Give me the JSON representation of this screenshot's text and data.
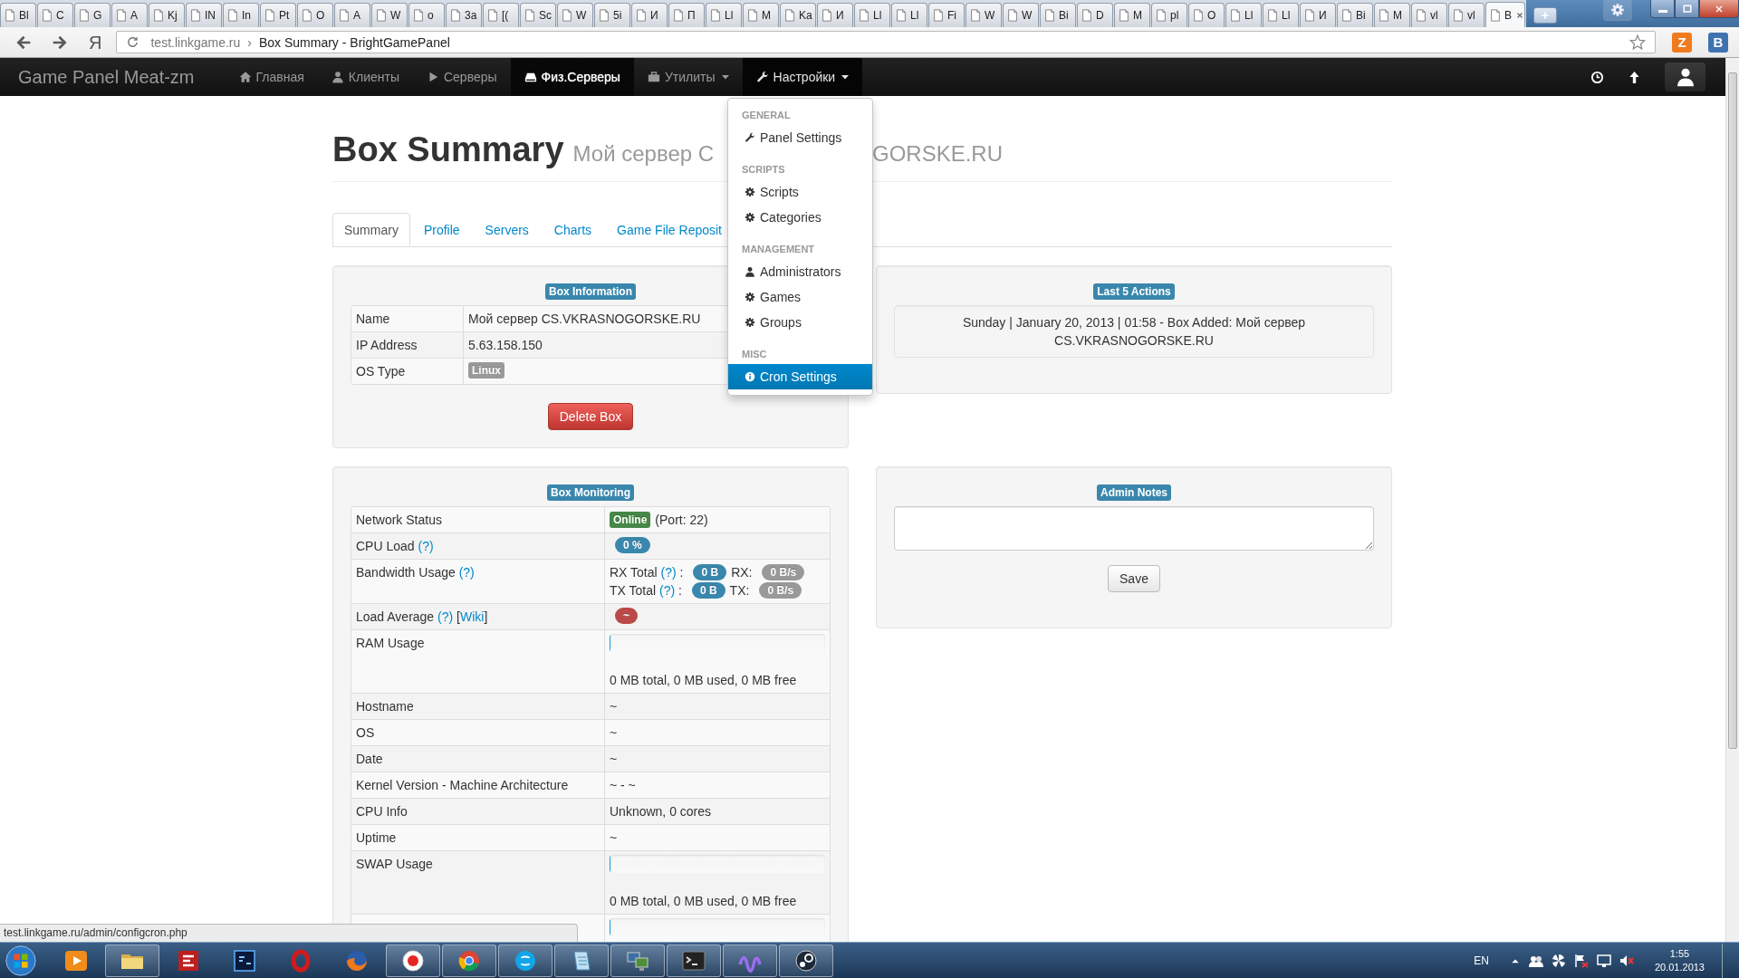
{
  "browser": {
    "tabs": [
      {
        "title": "Bl",
        "selected": false
      },
      {
        "title": "C",
        "selected": false
      },
      {
        "title": "G",
        "selected": false
      },
      {
        "title": "A",
        "selected": false
      },
      {
        "title": "Kj",
        "selected": false
      },
      {
        "title": "IN",
        "selected": false
      },
      {
        "title": "In",
        "selected": false
      },
      {
        "title": "Pt",
        "selected": false
      },
      {
        "title": "O",
        "selected": false
      },
      {
        "title": "A",
        "selected": false
      },
      {
        "title": "W",
        "selected": false
      },
      {
        "title": "o",
        "selected": false
      },
      {
        "title": "3a",
        "selected": false
      },
      {
        "title": "[(",
        "selected": false
      },
      {
        "title": "Sc",
        "selected": false
      },
      {
        "title": "W",
        "selected": false
      },
      {
        "title": "5i",
        "selected": false
      },
      {
        "title": "И",
        "selected": false
      },
      {
        "title": "П",
        "selected": false
      },
      {
        "title": "Ll",
        "selected": false
      },
      {
        "title": "M",
        "selected": false
      },
      {
        "title": "Ka",
        "selected": false
      },
      {
        "title": "И",
        "selected": false
      },
      {
        "title": "Ll",
        "selected": false
      },
      {
        "title": "Ll",
        "selected": false
      },
      {
        "title": "Fi",
        "selected": false
      },
      {
        "title": "W",
        "selected": false
      },
      {
        "title": "W",
        "selected": false
      },
      {
        "title": "Bi",
        "selected": false
      },
      {
        "title": "D",
        "selected": false
      },
      {
        "title": "M",
        "selected": false
      },
      {
        "title": "pl",
        "selected": false
      },
      {
        "title": "O",
        "selected": false
      },
      {
        "title": "Ll",
        "selected": false
      },
      {
        "title": "Ll",
        "selected": false
      },
      {
        "title": "И",
        "selected": false
      },
      {
        "title": "Bi",
        "selected": false
      },
      {
        "title": "M",
        "selected": false
      },
      {
        "title": "vl",
        "selected": false
      },
      {
        "title": "vl",
        "selected": false
      },
      {
        "title": "B",
        "selected": true
      }
    ],
    "search_engine": "Я",
    "address": {
      "host": "test.linkgame.ru",
      "separator": "›",
      "title": "Box Summary - BrightGamePanel"
    },
    "extensions": [
      "Z",
      "B"
    ]
  },
  "navbar": {
    "brand": "Game Panel Meat-zm",
    "items": [
      {
        "label": "Главная",
        "selected": false,
        "expanded": false,
        "dropdown": false
      },
      {
        "label": "Клиенты",
        "selected": false,
        "expanded": false,
        "dropdown": false
      },
      {
        "label": "Серверы",
        "selected": false,
        "expanded": false,
        "dropdown": false
      },
      {
        "label": "Физ.Серверы",
        "selected": true,
        "expanded": false,
        "dropdown": false
      },
      {
        "label": "Утилиты",
        "selected": false,
        "expanded": false,
        "dropdown": true
      },
      {
        "label": "Настройки",
        "selected": false,
        "expanded": true,
        "dropdown": true
      }
    ]
  },
  "menu": {
    "sections": [
      {
        "header": "GENERAL",
        "items": [
          {
            "label": "Panel Settings",
            "selected": false
          }
        ]
      },
      {
        "header": "SCRIPTS",
        "items": [
          {
            "label": "Scripts",
            "selected": false
          },
          {
            "label": "Categories",
            "selected": false
          }
        ]
      },
      {
        "header": "MANAGEMENT",
        "items": [
          {
            "label": "Administrators",
            "selected": false
          },
          {
            "label": "Games",
            "selected": false
          },
          {
            "label": "Groups",
            "selected": false
          }
        ]
      },
      {
        "header": "MISC",
        "items": [
          {
            "label": "Cron Settings",
            "selected": true
          }
        ]
      }
    ]
  },
  "page": {
    "title": "Box Summary",
    "subtitle_parts": [
      "Мой сервер C",
      "GORSKE.RU"
    ],
    "tabs": [
      {
        "label": "Summary",
        "selected": true
      },
      {
        "label": "Profile",
        "selected": false
      },
      {
        "label": "Servers",
        "selected": false
      },
      {
        "label": "Charts",
        "selected": false
      },
      {
        "label": "Game File Reposit",
        "selected": false
      }
    ],
    "box_information": {
      "badge": "Box Information",
      "rows": [
        {
          "label": [
            {
              "kind": "text",
              "text": "Name"
            }
          ],
          "value": [
            [
              {
                "kind": "text",
                "text": "Мой сервер CS.VKRASNOGORSKE.RU"
              }
            ]
          ]
        },
        {
          "label": [
            {
              "kind": "text",
              "text": "IP Address"
            }
          ],
          "value": [
            [
              {
                "kind": "text",
                "text": "5.63.158.150"
              }
            ]
          ]
        },
        {
          "label": [
            {
              "kind": "text",
              "text": "OS Type"
            }
          ],
          "value": [
            [
              {
                "kind": "label",
                "text": "Linux",
                "color": "#999999"
              }
            ]
          ]
        }
      ],
      "delete_button": "Delete Box"
    },
    "last_actions": {
      "badge": "Last 5 Actions",
      "entries": [
        "Sunday | January 20, 2013 | 01:58 - Box Added: Мой сервер CS.VKRASNOGORSKE.RU"
      ]
    },
    "box_monitoring": {
      "badge": "Box Monitoring",
      "rows": [
        {
          "label": [
            {
              "kind": "text",
              "text": "Network Status"
            }
          ],
          "value": [
            [
              {
                "kind": "label",
                "text": "Online",
                "color": "#468847"
              },
              {
                "kind": "text",
                "text": "(Port: 22)"
              }
            ]
          ]
        },
        {
          "label": [
            {
              "kind": "text",
              "text": "CPU Load "
            },
            {
              "kind": "link",
              "text": "(?)"
            }
          ],
          "value": [
            [
              {
                "kind": "badge",
                "text": "0 %",
                "color": "#3a87ad"
              }
            ]
          ]
        },
        {
          "label": [
            {
              "kind": "text",
              "text": "Bandwidth Usage "
            },
            {
              "kind": "link",
              "text": "(?)"
            }
          ],
          "value": [
            [
              {
                "kind": "text",
                "text": "RX Total "
              },
              {
                "kind": "link",
                "text": "(?)"
              },
              {
                "kind": "text",
                "text": " :"
              },
              {
                "kind": "badge",
                "text": "0 B",
                "color": "#3a87ad"
              },
              {
                "kind": "text",
                "text": "RX:"
              },
              {
                "kind": "badge",
                "text": "0 B/s",
                "color": "#999999"
              }
            ],
            [
              {
                "kind": "text",
                "text": "TX Total "
              },
              {
                "kind": "link",
                "text": "(?)"
              },
              {
                "kind": "text",
                "text": " :"
              },
              {
                "kind": "badge",
                "text": "0 B",
                "color": "#3a87ad"
              },
              {
                "kind": "text",
                "text": "TX:"
              },
              {
                "kind": "badge",
                "text": "0 B/s",
                "color": "#999999"
              }
            ]
          ]
        },
        {
          "label": [
            {
              "kind": "text",
              "text": "Load Average "
            },
            {
              "kind": "link",
              "text": "(?)"
            },
            {
              "kind": "text",
              "text": " ["
            },
            {
              "kind": "link",
              "text": "Wiki"
            },
            {
              "kind": "text",
              "text": "]"
            }
          ],
          "value": [
            [
              {
                "kind": "badge",
                "text": "~",
                "color": "#b94a48"
              }
            ]
          ]
        },
        {
          "label": [
            {
              "kind": "text",
              "text": "RAM Usage"
            }
          ],
          "value": [
            [
              {
                "kind": "progress",
                "level": 0
              }
            ],
            [
              {
                "kind": "text",
                "text": "0 MB total, 0 MB used, 0 MB free"
              }
            ]
          ]
        },
        {
          "label": [
            {
              "kind": "text",
              "text": "Hostname"
            }
          ],
          "value": [
            [
              {
                "kind": "text",
                "text": "~"
              }
            ]
          ]
        },
        {
          "label": [
            {
              "kind": "text",
              "text": "OS"
            }
          ],
          "value": [
            [
              {
                "kind": "text",
                "text": "~"
              }
            ]
          ]
        },
        {
          "label": [
            {
              "kind": "text",
              "text": "Date"
            }
          ],
          "value": [
            [
              {
                "kind": "text",
                "text": "~"
              }
            ]
          ]
        },
        {
          "label": [
            {
              "kind": "text",
              "text": "Kernel Version - Machine Architecture"
            }
          ],
          "value": [
            [
              {
                "kind": "text",
                "text": "~ - ~"
              }
            ]
          ]
        },
        {
          "label": [
            {
              "kind": "text",
              "text": "CPU Info"
            }
          ],
          "value": [
            [
              {
                "kind": "text",
                "text": "Unknown, 0 cores"
              }
            ]
          ]
        },
        {
          "label": [
            {
              "kind": "text",
              "text": "Uptime"
            }
          ],
          "value": [
            [
              {
                "kind": "text",
                "text": "~"
              }
            ]
          ]
        },
        {
          "label": [
            {
              "kind": "text",
              "text": "SWAP Usage"
            }
          ],
          "value": [
            [
              {
                "kind": "progress",
                "level": 0
              }
            ],
            [
              {
                "kind": "text",
                "text": "0 MB total, 0 MB used, 0 MB free"
              }
            ]
          ]
        },
        {
          "value": [
            [
              {
                "kind": "progress",
                "level": 0
              }
            ]
          ]
        }
      ]
    },
    "admin_notes": {
      "badge": "Admin Notes",
      "save_button": "Save"
    }
  },
  "status_url": "test.linkgame.ru/admin/configcron.php",
  "taskbar": {
    "apps": [
      {
        "running": false
      },
      {
        "running": true
      },
      {
        "running": false
      },
      {
        "running": false
      },
      {
        "running": false
      },
      {
        "running": false
      },
      {
        "running": true
      },
      {
        "running": true
      },
      {
        "running": true
      },
      {
        "running": true
      },
      {
        "running": true
      },
      {
        "running": true
      },
      {
        "running": true
      },
      {
        "running": true
      }
    ],
    "language": "EN",
    "time": "1:55",
    "date": "20.01.2013"
  }
}
